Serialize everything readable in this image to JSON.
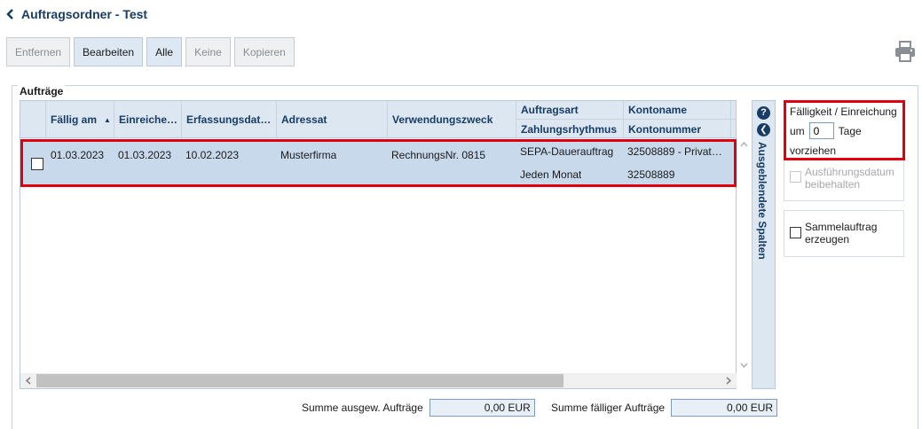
{
  "header": {
    "title": "Auftragsordner - Test"
  },
  "toolbar": {
    "buttons": [
      {
        "label": "Entfernen"
      },
      {
        "label": "Bearbeiten"
      },
      {
        "label": "Alle"
      },
      {
        "label": "Keine"
      },
      {
        "label": "Kopieren"
      }
    ]
  },
  "panel": {
    "title": "Aufträge"
  },
  "grid": {
    "columns": {
      "faellig": "Fällig am",
      "einreichung": "Einreiche…",
      "erfassung": "Erfassungsdat…",
      "adressat": "Adressat",
      "verwendung": "Verwendungszweck",
      "auftragsart": "Auftragsart",
      "rhythmus": "Zahlungsrhythmus",
      "kontoname": "Kontoname",
      "kontonummer": "Kontonummer",
      "next_top": "I",
      "next_bot": "I"
    },
    "row": {
      "faellig": "01.03.2023",
      "einreichung": "01.03.2023",
      "erfassung": "10.02.2023",
      "adressat": "Musterfirma",
      "verwendung": "RechnungsNr. 0815",
      "auftragsart": "SEPA-Dauerauftrag",
      "rhythmus": "Jeden Monat",
      "kontoname": "32508889 - Privat…",
      "kontonummer": "32508889"
    },
    "hidden_columns": "Ausgeblendete Spalten",
    "help": "?"
  },
  "totals": {
    "selected_label": "Summe ausgew. Aufträge",
    "selected_value": "0,00 EUR",
    "due_label": "Summe fälliger Aufträge",
    "due_value": "0,00 EUR"
  },
  "options": {
    "faelligkeit_title": "Fälligkeit / Einreichung",
    "um": "um",
    "days_value": "0",
    "tage": "Tage",
    "vorziehen": "vorziehen",
    "ausfuehrung": "Ausführungsdatum beibehalten",
    "sammel": "Sammelauftrag erzeugen"
  }
}
